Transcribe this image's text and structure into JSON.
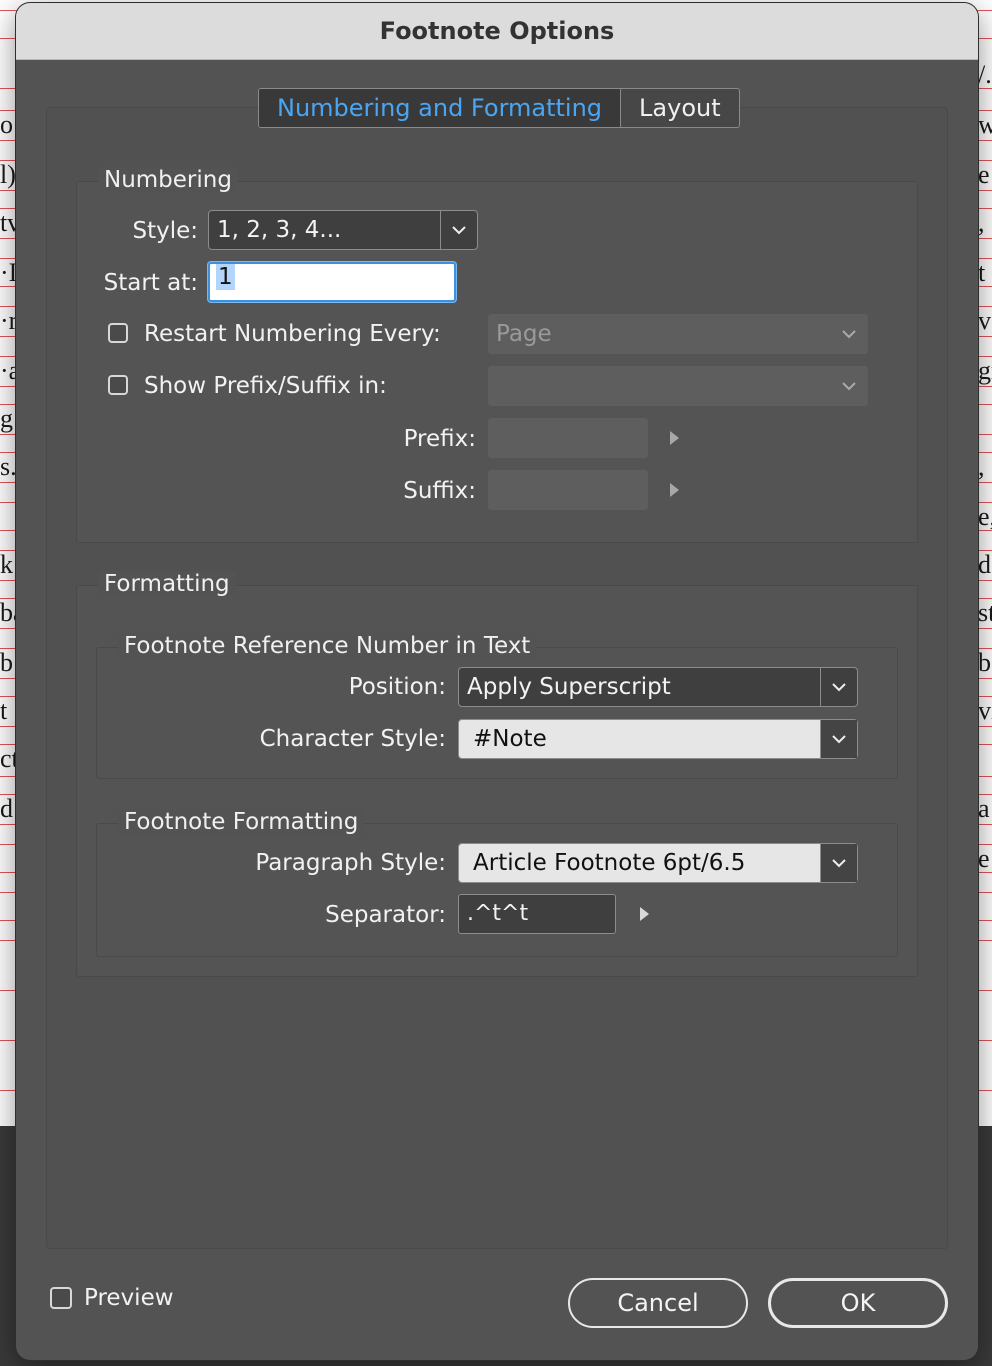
{
  "dialog": {
    "title": "Footnote Options"
  },
  "tabs": [
    {
      "label": "Numbering and Formatting",
      "active": true
    },
    {
      "label": "Layout",
      "active": false
    }
  ],
  "numbering": {
    "group_title": "Numbering",
    "style_label": "Style:",
    "style_value": "1, 2, 3, 4...",
    "start_label": "Start at:",
    "start_value": "1",
    "restart_label": "Restart Numbering Every:",
    "restart_checked": false,
    "restart_value": "Page",
    "prefix_suffix_label": "Show Prefix/Suffix in:",
    "prefix_suffix_checked": false,
    "prefix_suffix_value": "",
    "prefix_label": "Prefix:",
    "suffix_label": "Suffix:"
  },
  "formatting": {
    "group_title": "Formatting",
    "reference": {
      "title": "Footnote Reference Number in Text",
      "position_label": "Position:",
      "position_value": "Apply Superscript",
      "char_style_label": "Character Style:",
      "char_style_value": "#Note"
    },
    "footnote": {
      "title": "Footnote Formatting",
      "para_style_label": "Paragraph Style:",
      "para_style_value": "Article Footnote 6pt/6.5",
      "separator_label": "Separator:",
      "separator_value": ".^t^t"
    }
  },
  "footer": {
    "preview_label": "Preview",
    "preview_checked": false,
    "cancel_label": "Cancel",
    "ok_label": "OK"
  },
  "background_edge_text": {
    "left": [
      "o",
      "l)",
      "tv",
      "·I",
      "·r",
      "·a",
      "g",
      "s.l",
      "k",
      "ba",
      "b",
      "t",
      "ct",
      "d"
    ],
    "right": [
      "/.",
      "w",
      "e",
      ",",
      "t",
      "v",
      "gr",
      ",",
      "e,",
      "d",
      "st",
      "b",
      "vi",
      "a",
      "e"
    ]
  },
  "colors": {
    "dialog_bg": "#535353",
    "titlebar_bg": "#dcdcdc",
    "accent_tab_text": "#4aa6f2",
    "focus_ring": "#3d8fe0"
  }
}
